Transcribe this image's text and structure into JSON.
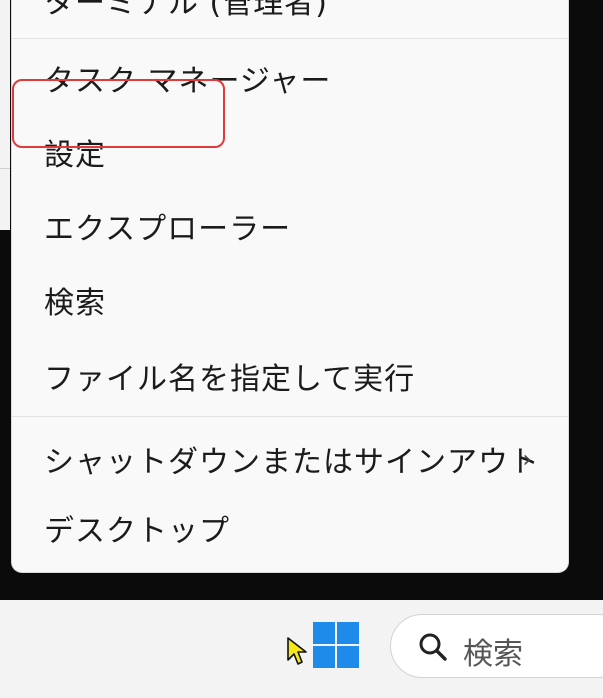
{
  "menu": {
    "items": [
      {
        "label": "ターミナル (管理者)"
      },
      {
        "label": "タスク マネージャー"
      },
      {
        "label": "設定"
      },
      {
        "label": "エクスプローラー"
      },
      {
        "label": "検索"
      },
      {
        "label": "ファイル名を指定して実行"
      },
      {
        "label": "シャットダウンまたはサインアウト",
        "chevron": "›"
      },
      {
        "label": "デスクトップ"
      }
    ]
  },
  "highlight": {
    "target": "設定",
    "color": "#e03b3b"
  },
  "taskbar": {
    "start_icon": "windows-logo-icon",
    "search": {
      "icon": "search-icon",
      "placeholder": "検索"
    }
  }
}
